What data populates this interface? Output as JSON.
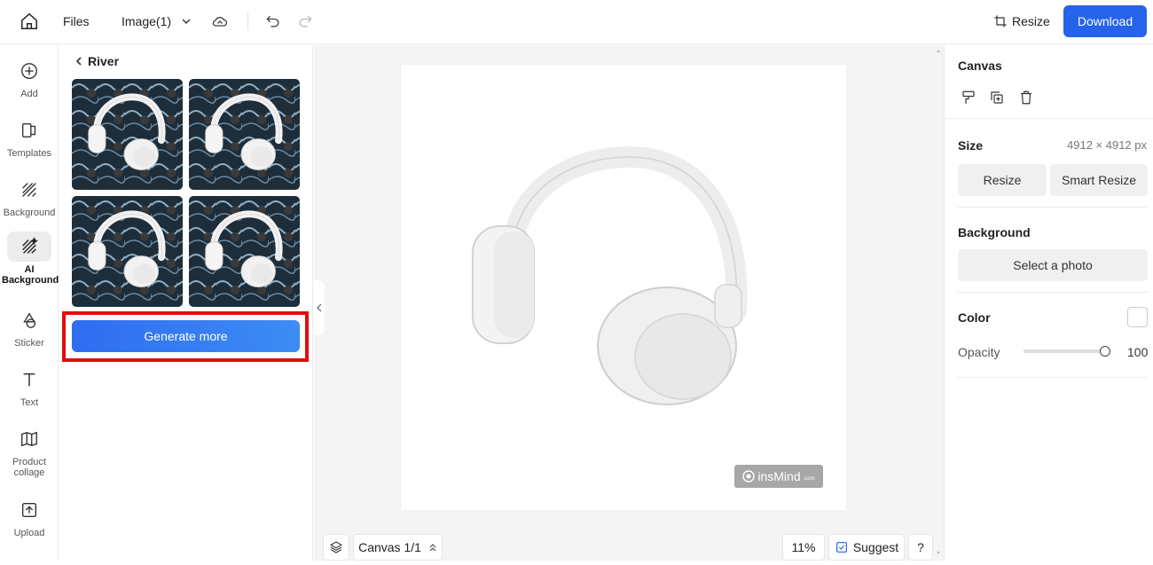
{
  "topbar": {
    "files_label": "Files",
    "image_label": "Image(1)",
    "resize_label": "Resize",
    "download_label": "Download"
  },
  "leftnav": {
    "items": [
      {
        "label": "Add",
        "icon": "plus-circle-icon"
      },
      {
        "label": "Templates",
        "icon": "templates-icon"
      },
      {
        "label": "Background",
        "icon": "background-icon"
      },
      {
        "label": "AI Background",
        "icon": "ai-background-icon",
        "active": true
      },
      {
        "label": "Sticker",
        "icon": "sticker-icon"
      },
      {
        "label": "Text",
        "icon": "text-icon"
      },
      {
        "label": "Product collage",
        "icon": "collage-icon"
      },
      {
        "label": "Upload",
        "icon": "upload-icon"
      }
    ]
  },
  "panel": {
    "back_label": "River",
    "generate_label": "Generate more"
  },
  "canvas": {
    "watermark_text": "insMind",
    "watermark_suffix": ".com",
    "canvas_label": "Canvas 1/1",
    "zoom": "11%",
    "suggest_label": "Suggest",
    "help_label": "?"
  },
  "rightpanel": {
    "canvas_title": "Canvas",
    "size_title": "Size",
    "size_value": "4912 × 4912 px",
    "resize_label": "Resize",
    "smart_resize_label": "Smart Resize",
    "background_title": "Background",
    "select_photo_label": "Select a photo",
    "color_title": "Color",
    "opacity_title": "Opacity",
    "opacity_value": "100"
  },
  "colors": {
    "accent": "#2563eb",
    "highlight": "#e10d0d"
  }
}
